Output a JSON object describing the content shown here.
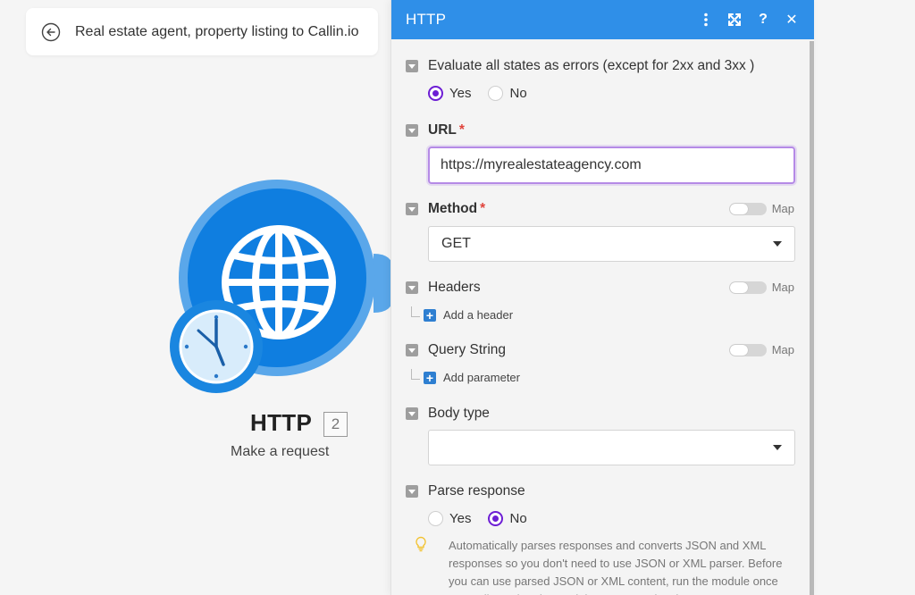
{
  "breadcrumb": {
    "title": "Real estate agent, property listing to Callin.io",
    "back_icon": "arrow-left-circle-icon"
  },
  "node": {
    "name": "HTTP",
    "badge": "2",
    "subtitle": "Make a request",
    "primary_color": "#0f7ee0",
    "ring_color": "#5aa7ea",
    "icon": "globe-icon",
    "overlay_icon": "clock-icon"
  },
  "panel": {
    "title": "HTTP",
    "header_color": "#2f8fe8",
    "header_icons": [
      "more-vertical-icon",
      "expand-icon",
      "help-icon",
      "close-icon"
    ],
    "header_glyphs": {
      "help": "?",
      "close": "✕"
    },
    "evaluate_errors": {
      "label": "Evaluate all states as errors (except for 2xx and 3xx )",
      "options": [
        "Yes",
        "No"
      ],
      "selected": "Yes"
    },
    "url": {
      "label": "URL",
      "required_mark": "*",
      "value": "https://myrealestateagency.com"
    },
    "method": {
      "label": "Method",
      "required_mark": "*",
      "value": "GET",
      "map_label": "Map"
    },
    "headers": {
      "label": "Headers",
      "map_label": "Map",
      "add_label": "Add a header",
      "add_glyph": "+"
    },
    "query_string": {
      "label": "Query String",
      "map_label": "Map",
      "add_label": "Add parameter",
      "add_glyph": "+"
    },
    "body_type": {
      "label": "Body type",
      "value": ""
    },
    "parse_response": {
      "label": "Parse response",
      "options": [
        "Yes",
        "No"
      ],
      "selected": "No",
      "hint": "Automatically parses responses and converts JSON and XML responses so you don't need to use JSON or XML parser. Before you can use parsed JSON or XML content, run the module once manually so that the module can recognize the response content"
    },
    "accent_color": "#6d1ed4",
    "hint_icon": "lightbulb-icon"
  }
}
